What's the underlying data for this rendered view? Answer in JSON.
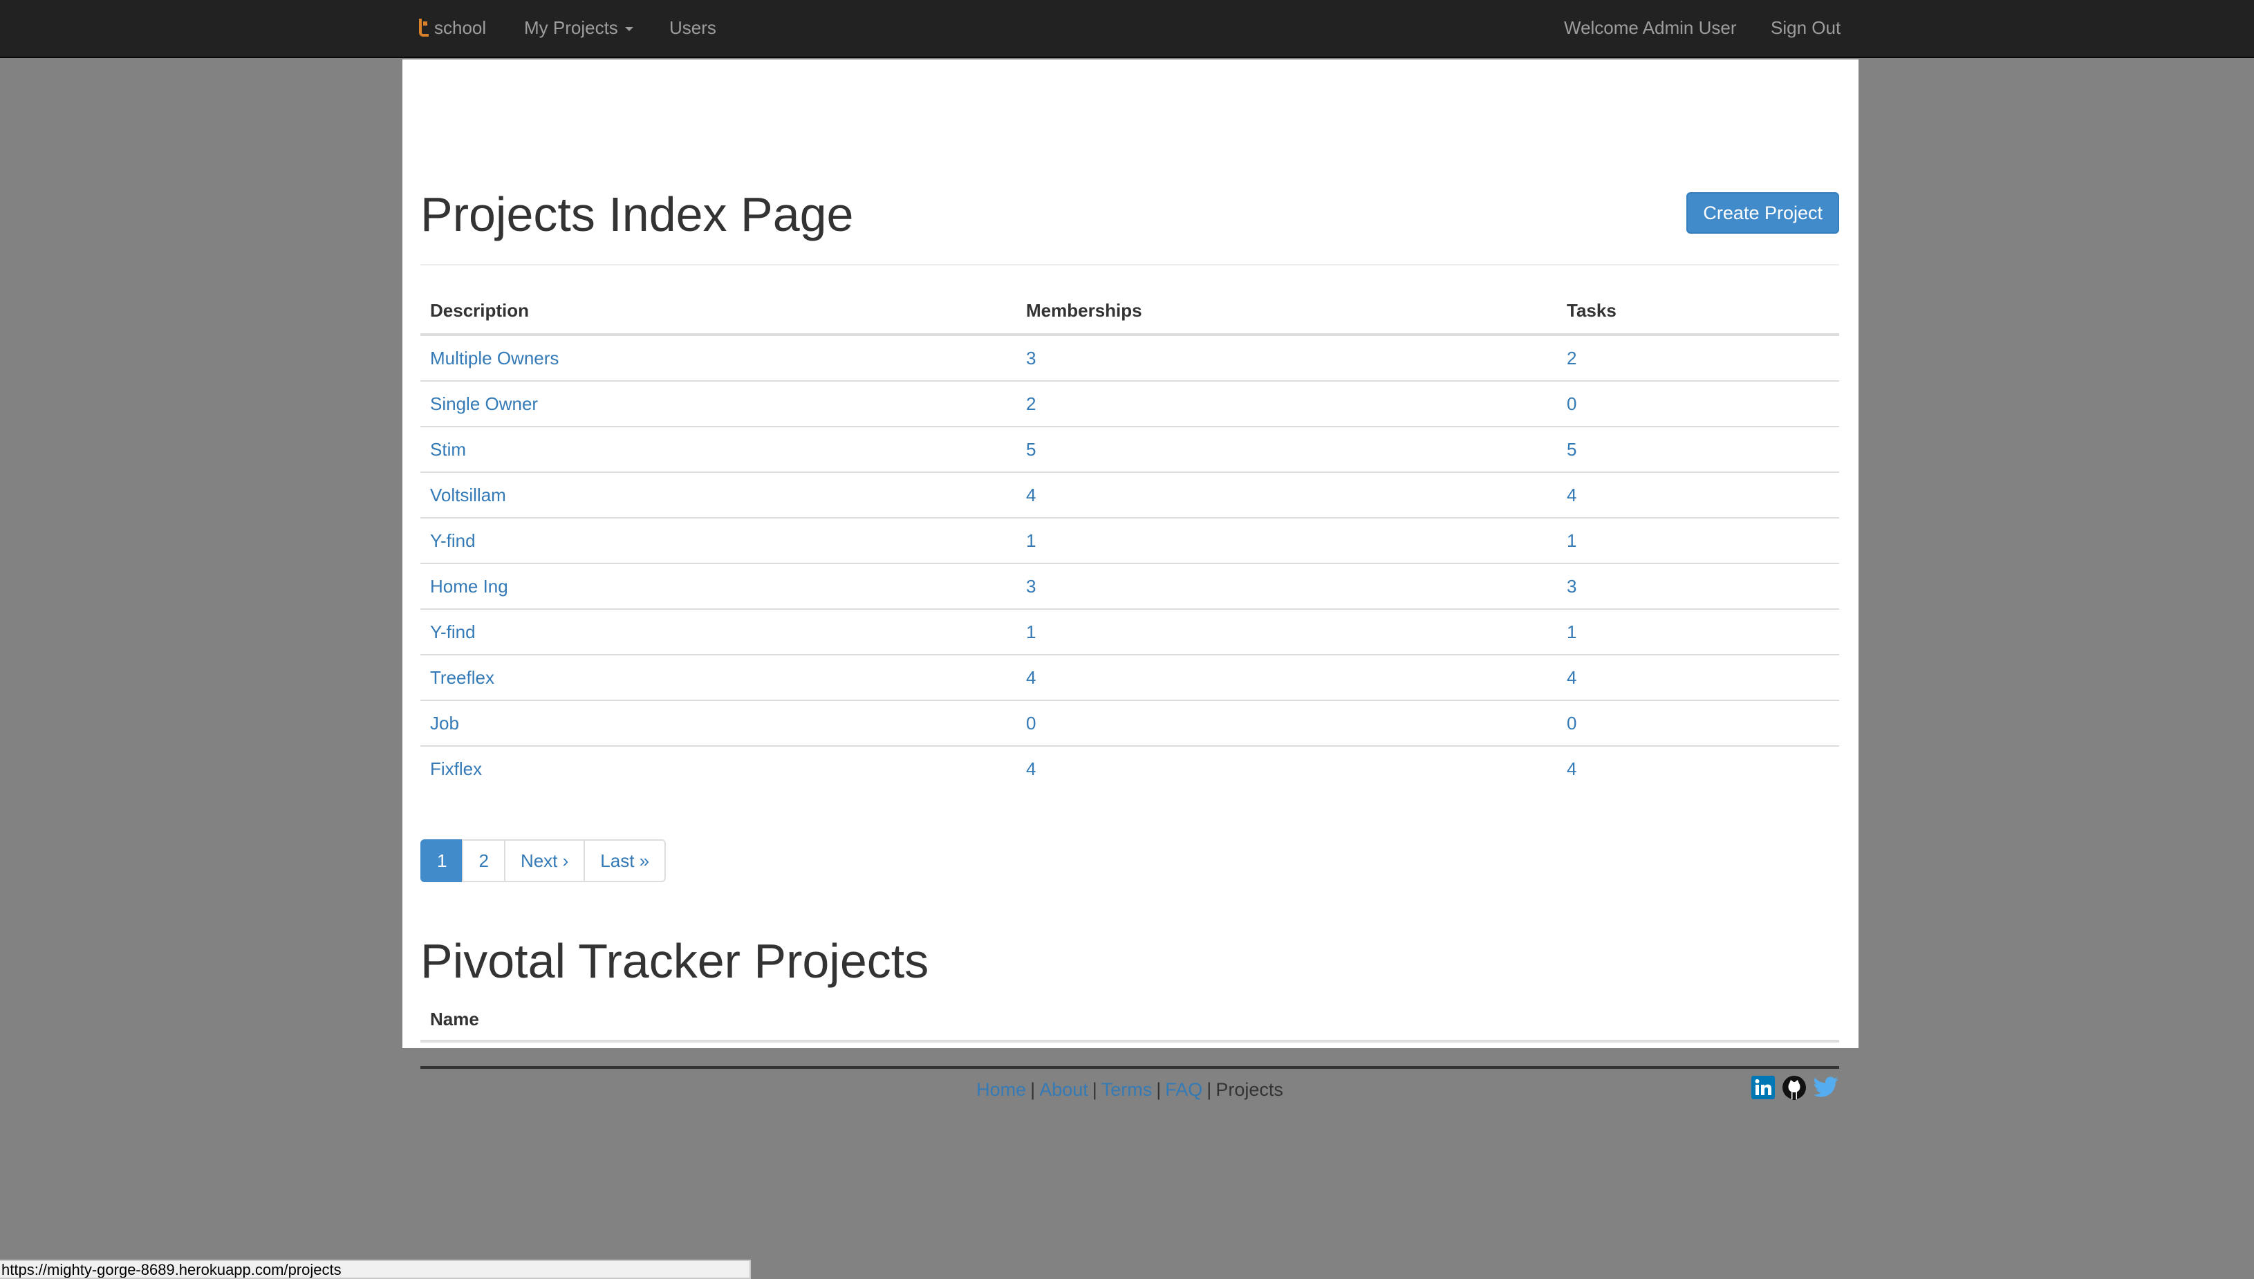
{
  "navbar": {
    "brand": "school",
    "my_projects": "My Projects",
    "users": "Users",
    "welcome": "Welcome Admin User",
    "sign_out": "Sign Out"
  },
  "main": {
    "title": "Projects Index Page",
    "create_button": "Create Project",
    "table": {
      "headers": [
        "Description",
        "Memberships",
        "Tasks"
      ],
      "rows": [
        {
          "description": "Multiple Owners",
          "memberships": "3",
          "tasks": "2"
        },
        {
          "description": "Single Owner",
          "memberships": "2",
          "tasks": "0"
        },
        {
          "description": "Stim",
          "memberships": "5",
          "tasks": "5"
        },
        {
          "description": "Voltsillam",
          "memberships": "4",
          "tasks": "4"
        },
        {
          "description": "Y-find",
          "memberships": "1",
          "tasks": "1"
        },
        {
          "description": "Home Ing",
          "memberships": "3",
          "tasks": "3"
        },
        {
          "description": "Y-find",
          "memberships": "1",
          "tasks": "1"
        },
        {
          "description": "Treeflex",
          "memberships": "4",
          "tasks": "4"
        },
        {
          "description": "Job",
          "memberships": "0",
          "tasks": "0"
        },
        {
          "description": "Fixflex",
          "memberships": "4",
          "tasks": "4"
        }
      ]
    },
    "pagination": {
      "pages": [
        "1",
        "2"
      ],
      "active": "1",
      "next": "Next ›",
      "last": "Last »"
    },
    "pivotal": {
      "title": "Pivotal Tracker Projects",
      "name_header": "Name"
    }
  },
  "footer": {
    "links": [
      "Home",
      "About",
      "Terms",
      "FAQ"
    ],
    "current": "Projects",
    "separator": "|",
    "social_icons": [
      "linkedin-icon",
      "github-icon",
      "twitter-icon"
    ]
  },
  "status_bar": {
    "url": "https://mighty-gorge-8689.herokuapp.com/projects"
  },
  "colors": {
    "navbar_bg": "#222222",
    "link": "#337ab7",
    "primary": "#428bca",
    "page_bg": "#828282",
    "brand_logo": "#d9822b"
  }
}
